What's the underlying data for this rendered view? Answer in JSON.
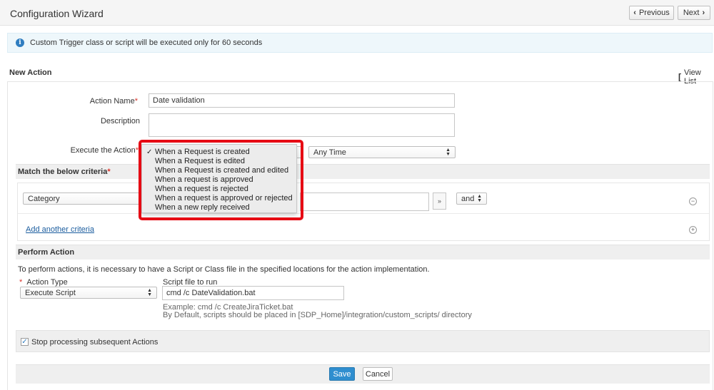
{
  "header": {
    "title": "Configuration Wizard",
    "previous_label": "Previous",
    "next_label": "Next"
  },
  "info": {
    "message": "Custom Trigger class or script will be executed only for 60 seconds"
  },
  "section": {
    "title": "New Action",
    "view_list_label": "View List"
  },
  "form": {
    "action_name_label": "Action Name",
    "action_name_value": "Date validation",
    "description_label": "Description",
    "description_value": "",
    "execute_label": "Execute the Action",
    "execute_options": [
      "When a Request is created",
      "When a Request is edited",
      "When a Request is created and edited",
      "When a request is approved",
      "When a request is rejected",
      "When a request is approved or rejected",
      "When a new reply received"
    ],
    "execute_selected_index": 0,
    "time_value": "Any Time",
    "required_mark": "*"
  },
  "criteria": {
    "title": "Match the below criteria",
    "field_value": "Category",
    "operator_value": "and",
    "add_label": "Add another criteria",
    "remove_symbol": "−",
    "add_symbol": "+"
  },
  "perform": {
    "title": "Perform Action",
    "note": "To perform actions, it is necessary to have a Script or Class file in the specified locations for the action implementation.",
    "action_type_label": "Action Type",
    "action_type_value": "Execute Script",
    "script_label": "Script file to run",
    "script_value": "cmd /c DateValidation.bat",
    "example_prefix": "Example:",
    "example_value": "cmd /c CreateJiraTicket.bat",
    "default_note": "By Default, scripts should be placed in [SDP_Home]/integration/custom_scripts/ directory"
  },
  "stop": {
    "label": "Stop processing subsequent Actions",
    "checked": true
  },
  "footer": {
    "save_label": "Save",
    "cancel_label": "Cancel"
  },
  "colors": {
    "accent": "#2f8ecf",
    "highlight": "#e60a14",
    "required": "#d9342b"
  }
}
